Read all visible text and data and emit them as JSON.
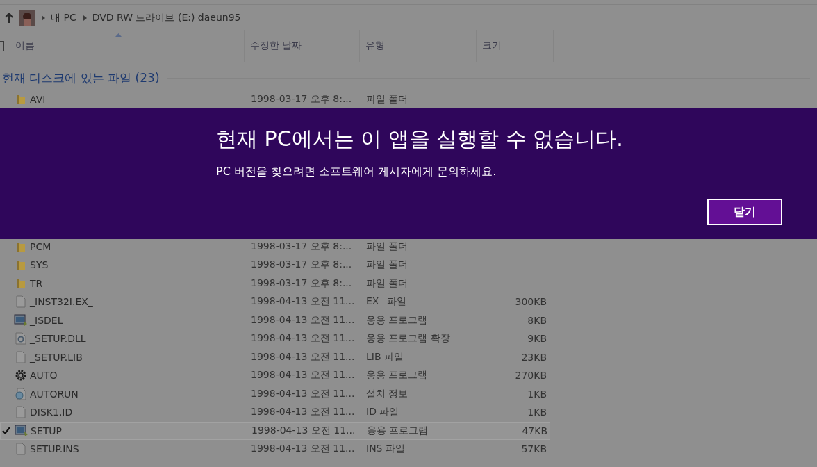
{
  "breadcrumb": [
    "내 PC",
    "DVD RW 드라이브 (E:) daeun95"
  ],
  "columns": [
    "이름",
    "수정한 날짜",
    "유형",
    "크기"
  ],
  "select_all": {
    "checked": false
  },
  "group": {
    "label": "현재 디스크에 있는 파일 (23)"
  },
  "files": [
    {
      "kind": "folder",
      "name": "AVI",
      "date": "1998-03-17 오후 8:...",
      "type": "파일 폴더",
      "selected": false,
      "checked": false
    },
    {
      "kind": "folder",
      "name": "PCM",
      "date": "1998-03-17 오후 8:...",
      "type": "파일 폴더",
      "selected": false,
      "checked": false
    },
    {
      "kind": "folder",
      "name": "SYS",
      "date": "1998-03-17 오후 8:...",
      "type": "파일 폴더",
      "selected": false,
      "checked": false
    },
    {
      "kind": "folder",
      "name": "TR",
      "date": "1998-03-17 오후 8:...",
      "type": "파일 폴더",
      "selected": false,
      "checked": false
    },
    {
      "kind": "file",
      "name": "_INST32I.EX_",
      "date": "1998-04-13 오전 11...",
      "type": "EX_ 파일",
      "size": "300KB",
      "selected": false,
      "checked": false
    },
    {
      "kind": "app",
      "name": "_ISDEL",
      "date": "1998-04-13 오전 11...",
      "type": "응용 프로그램",
      "size": "8KB",
      "selected": false,
      "checked": false
    },
    {
      "kind": "dll",
      "name": "_SETUP.DLL",
      "date": "1998-04-13 오전 11...",
      "type": "응용 프로그램 확장",
      "size": "9KB",
      "selected": false,
      "checked": false
    },
    {
      "kind": "file",
      "name": "_SETUP.LIB",
      "date": "1998-04-13 오전 11...",
      "type": "LIB 파일",
      "size": "23KB",
      "selected": false,
      "checked": false
    },
    {
      "kind": "gear",
      "name": "AUTO",
      "date": "1998-04-13 오전 11...",
      "type": "응용 프로그램",
      "size": "270KB",
      "selected": false,
      "checked": false
    },
    {
      "kind": "inf",
      "name": "AUTORUN",
      "date": "1998-04-13 오전 11...",
      "type": "설치 정보",
      "size": "1KB",
      "selected": false,
      "checked": false
    },
    {
      "kind": "file",
      "name": "DISK1.ID",
      "date": "1998-04-13 오전 11...",
      "type": "ID 파일",
      "size": "1KB",
      "selected": false,
      "checked": false
    },
    {
      "kind": "app",
      "name": "SETUP",
      "date": "1998-04-13 오전 11...",
      "type": "응용 프로그램",
      "size": "47KB",
      "selected": true,
      "checked": true
    },
    {
      "kind": "file",
      "name": "SETUP.INS",
      "date": "1998-04-13 오전 11...",
      "type": "INS 파일",
      "size": "57KB",
      "selected": false,
      "checked": false
    }
  ],
  "dialog": {
    "title": "현재 PC에서는 이 앱을 실행할 수 없습니다.",
    "message": "PC 버전을 찾으려면 소프트웨어 게시자에게 문의하세요.",
    "button": "닫기"
  }
}
